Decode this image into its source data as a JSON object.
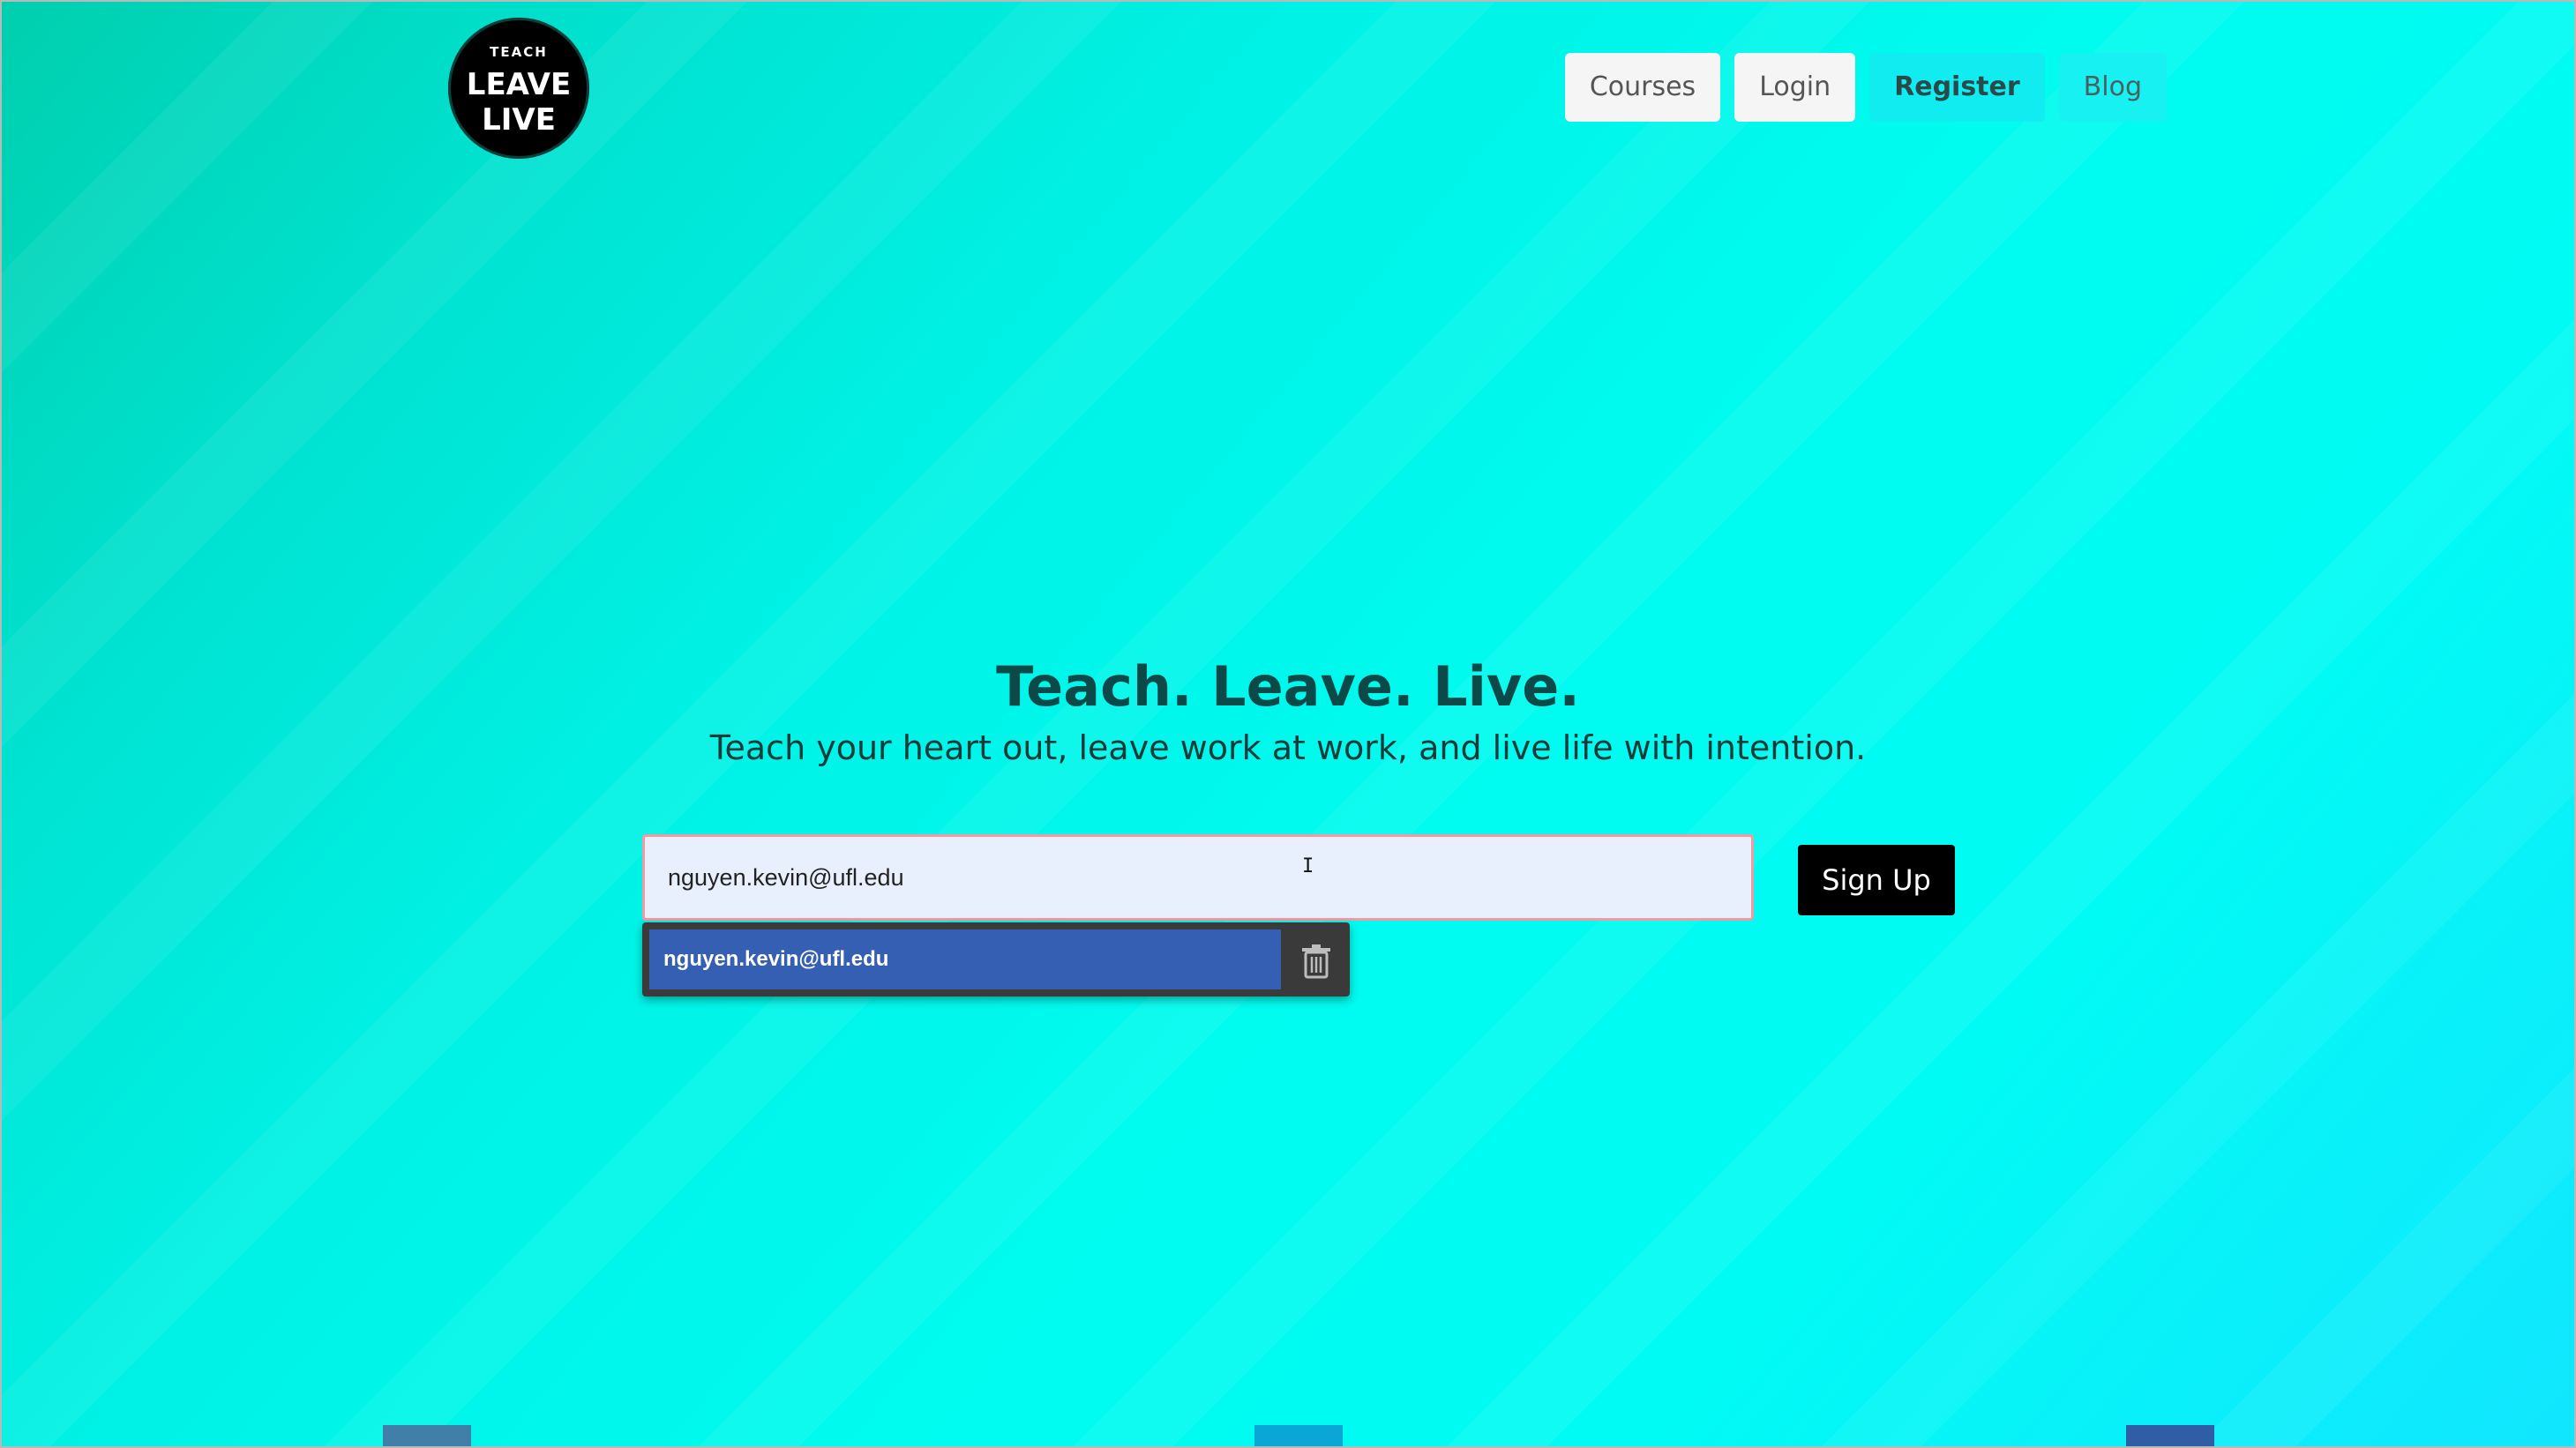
{
  "logo": {
    "line_small": "TEACH",
    "line_big1": "LEAVE",
    "line_big2": "LIVE"
  },
  "nav": {
    "items": [
      {
        "label": "Courses"
      },
      {
        "label": "Login"
      },
      {
        "label": "Register"
      },
      {
        "label": "Blog"
      }
    ]
  },
  "hero": {
    "title": "Teach. Leave. Live.",
    "subtitle": "Teach your heart out, leave work at work, and live life with intention."
  },
  "form": {
    "email_value": "nguyen.kevin@ufl.edu",
    "signup_label": "Sign Up"
  },
  "autofill": {
    "suggestion": "nguyen.kevin@ufl.edu",
    "delete_icon": "trash-icon"
  },
  "cursor": {
    "symbol": "I"
  },
  "colors": {
    "bg_start": "#00cfae",
    "bg_end": "#11e6ff",
    "title": "#0c4a4a",
    "signup_bg": "#000000",
    "autofill_selected": "#345fb2",
    "input_border": "#f39aa0",
    "input_bg": "#e8f0fe"
  }
}
